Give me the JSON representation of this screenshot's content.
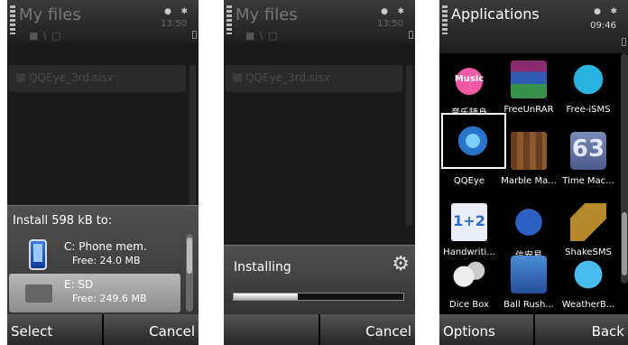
{
  "screen1": {
    "title": "My files",
    "clock": "13:50",
    "path": "■ \\ □",
    "file_item": "QQEye_3rd.sisx",
    "popup": {
      "title": "Install 598 kB to:",
      "options": [
        {
          "name": "C: Phone mem.",
          "free": "Free: 24.0 MB",
          "icon": "phone-memory-icon",
          "selected": false
        },
        {
          "name": "E: SD",
          "free": "Free: 249.6 MB",
          "icon": "sd-card-icon",
          "selected": true
        }
      ]
    },
    "softkeys": {
      "left": "Select",
      "right": "Cancel"
    }
  },
  "screen2": {
    "title": "My files",
    "clock": "13:50",
    "path": "■ \\ □",
    "file_item": "QQEye_3rd.sisx",
    "installing": {
      "label": "Installing",
      "progress": 0.38,
      "icon": "gear-icon"
    },
    "softkeys": {
      "left": "",
      "right": "Cancel"
    }
  },
  "screen3": {
    "title": "Applications",
    "clock": "09:46",
    "apps": [
      {
        "label": "音乐随身",
        "icon": "music-icon",
        "icon_text": "Music"
      },
      {
        "label": "FreeUnRAR",
        "icon": "winrar-icon"
      },
      {
        "label": "Free-iSMS",
        "icon": "chat-bubble-icon"
      },
      {
        "label": "QQEye",
        "icon": "qqeye-icon",
        "selected": true
      },
      {
        "label": "Marble Ma...",
        "icon": "marble-maze-icon"
      },
      {
        "label": "Time Mac...",
        "icon": "time-machine-icon",
        "icon_text": "63"
      },
      {
        "label": "Handwriti...",
        "icon": "handwriting-icon",
        "icon_text": "1+2"
      },
      {
        "label": "信安易",
        "icon": "shield-icon"
      },
      {
        "label": "ShakeSMS",
        "icon": "envelope-icon"
      },
      {
        "label": "Dice Box",
        "icon": "dice-icon"
      },
      {
        "label": "Ball Rush...",
        "icon": "ball-rush-icon"
      },
      {
        "label": "WeatherB...",
        "icon": "weather-icon"
      }
    ],
    "softkeys": {
      "left": "Options",
      "right": "Back"
    }
  }
}
